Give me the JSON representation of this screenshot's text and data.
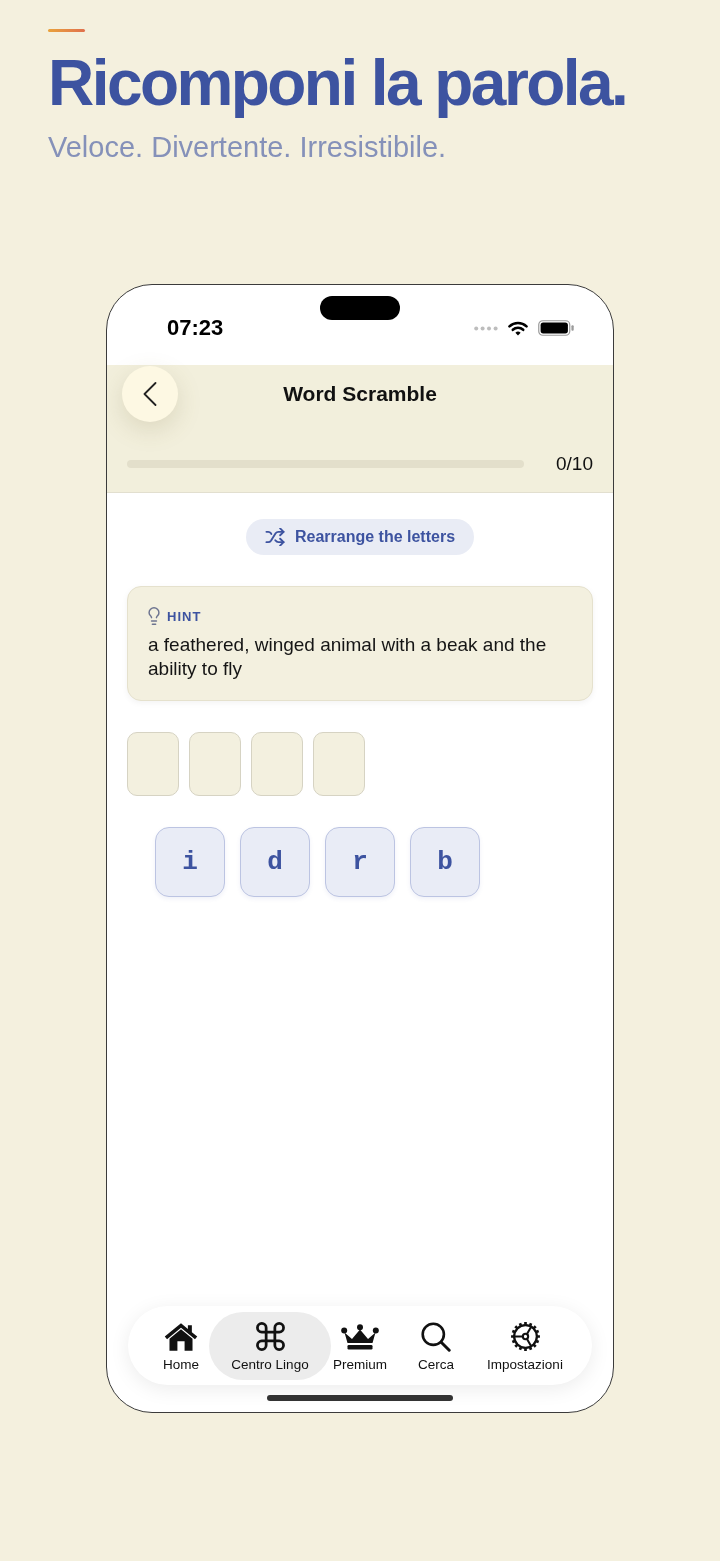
{
  "promo": {
    "headline": "Ricomponi la parola.",
    "tagline": "Veloce. Divertente. Irresistibile."
  },
  "status_bar": {
    "time": "07:23"
  },
  "nav_bar": {
    "title": "Word Scramble"
  },
  "progress": {
    "level": 0,
    "reading": "0/10"
  },
  "rearrange_button": {
    "label": "Rearrange the letters"
  },
  "hint": {
    "label": "HINT",
    "text": "a feathered, winged animal with a beak and the ability to fly"
  },
  "answer_slots": [
    {
      "filled": false
    },
    {
      "filled": false
    },
    {
      "filled": false
    },
    {
      "filled": false
    }
  ],
  "letter_tiles": [
    {
      "letter": "i"
    },
    {
      "letter": "d"
    },
    {
      "letter": "r"
    },
    {
      "letter": "b"
    }
  ],
  "tab_bar": {
    "items": [
      {
        "label": "Home",
        "selected": false
      },
      {
        "label": "Centro Lingo",
        "selected": true
      },
      {
        "label": "Premium",
        "selected": false
      },
      {
        "label": "Cerca",
        "selected": false
      },
      {
        "label": "Impostazioni",
        "selected": false
      }
    ]
  }
}
